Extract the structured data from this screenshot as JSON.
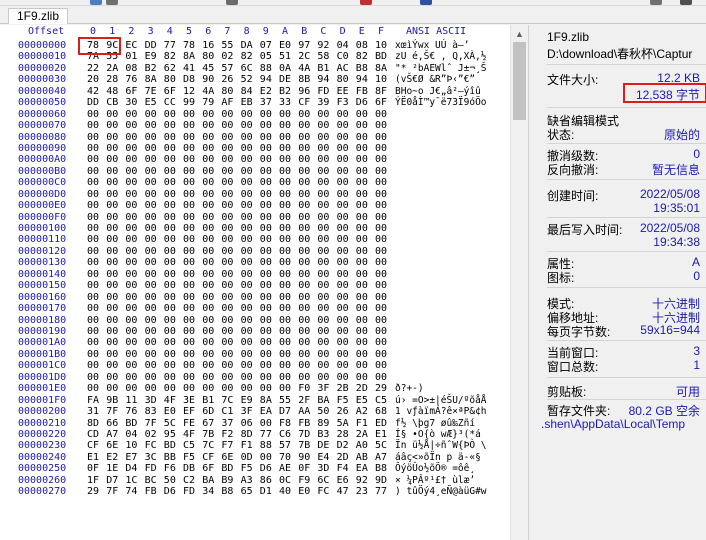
{
  "tab": {
    "label": "1F9.zlib"
  },
  "hex_header": {
    "offset_label": "Offset",
    "columns": [
      "0",
      "1",
      "2",
      "3",
      "4",
      "5",
      "6",
      "7",
      "8",
      "9",
      "A",
      "B",
      "C",
      "D",
      "E",
      "F"
    ],
    "ascii_label": "ANSI ASCII"
  },
  "hex_rows": [
    {
      "offset": "00000000",
      "bytes": [
        "78",
        "9C",
        "EC",
        "DD",
        "77",
        "78",
        "16",
        "55",
        "DA",
        "07",
        "E0",
        "97",
        "92",
        "04",
        "08",
        "10"
      ],
      "ascii": "xœìÝwx UÚ  à—’"
    },
    {
      "offset": "00000010",
      "bytes": [
        "7A",
        "55",
        "01",
        "E9",
        "82",
        "8A",
        "80",
        "02",
        "82",
        "05",
        "51",
        "2C",
        "58",
        "C0",
        "82",
        "BD"
      ],
      "ascii": "zU é,Š€ , Q,XÀ,½"
    },
    {
      "offset": "00000020",
      "bytes": [
        "22",
        "2A",
        "08",
        "B2",
        "62",
        "41",
        "45",
        "57",
        "6C",
        "88",
        "0A",
        "4A",
        "B1",
        "AC",
        "B8",
        "8A"
      ],
      "ascii": "\"* ²bAEWlˆ J±¬¸Š"
    },
    {
      "offset": "00000030",
      "bytes": [
        "20",
        "28",
        "76",
        "8A",
        "80",
        "D8",
        "90",
        "26",
        "52",
        "94",
        "DE",
        "8B",
        "94",
        "80",
        "94",
        "10"
      ],
      "ascii": " (vŠ€Ø &R”Þ‹”€”"
    },
    {
      "offset": "00000040",
      "bytes": [
        "42",
        "48",
        "6F",
        "7E",
        "6F",
        "12",
        "4A",
        "80",
        "84",
        "E2",
        "B2",
        "96",
        "FD",
        "EE",
        "FB",
        "8F"
      ],
      "ascii": "BHo~o J€„â²–ýîû"
    },
    {
      "offset": "00000050",
      "bytes": [
        "DD",
        "CB",
        "30",
        "E5",
        "CC",
        "99",
        "79",
        "AF",
        "EB",
        "37",
        "33",
        "CF",
        "39",
        "F3",
        "D6",
        "6F"
      ],
      "ascii": "ÝË0åÌ™y¯ë73Ï9óÖo"
    },
    {
      "offset": "00000060",
      "bytes": [
        "00",
        "00",
        "00",
        "00",
        "00",
        "00",
        "00",
        "00",
        "00",
        "00",
        "00",
        "00",
        "00",
        "00",
        "00",
        "00"
      ],
      "ascii": ""
    },
    {
      "offset": "00000070",
      "bytes": [
        "00",
        "00",
        "00",
        "00",
        "00",
        "00",
        "00",
        "00",
        "00",
        "00",
        "00",
        "00",
        "00",
        "00",
        "00",
        "00"
      ],
      "ascii": ""
    },
    {
      "offset": "00000080",
      "bytes": [
        "00",
        "00",
        "00",
        "00",
        "00",
        "00",
        "00",
        "00",
        "00",
        "00",
        "00",
        "00",
        "00",
        "00",
        "00",
        "00"
      ],
      "ascii": ""
    },
    {
      "offset": "00000090",
      "bytes": [
        "00",
        "00",
        "00",
        "00",
        "00",
        "00",
        "00",
        "00",
        "00",
        "00",
        "00",
        "00",
        "00",
        "00",
        "00",
        "00"
      ],
      "ascii": ""
    },
    {
      "offset": "000000A0",
      "bytes": [
        "00",
        "00",
        "00",
        "00",
        "00",
        "00",
        "00",
        "00",
        "00",
        "00",
        "00",
        "00",
        "00",
        "00",
        "00",
        "00"
      ],
      "ascii": ""
    },
    {
      "offset": "000000B0",
      "bytes": [
        "00",
        "00",
        "00",
        "00",
        "00",
        "00",
        "00",
        "00",
        "00",
        "00",
        "00",
        "00",
        "00",
        "00",
        "00",
        "00"
      ],
      "ascii": ""
    },
    {
      "offset": "000000C0",
      "bytes": [
        "00",
        "00",
        "00",
        "00",
        "00",
        "00",
        "00",
        "00",
        "00",
        "00",
        "00",
        "00",
        "00",
        "00",
        "00",
        "00"
      ],
      "ascii": ""
    },
    {
      "offset": "000000D0",
      "bytes": [
        "00",
        "00",
        "00",
        "00",
        "00",
        "00",
        "00",
        "00",
        "00",
        "00",
        "00",
        "00",
        "00",
        "00",
        "00",
        "00"
      ],
      "ascii": ""
    },
    {
      "offset": "000000E0",
      "bytes": [
        "00",
        "00",
        "00",
        "00",
        "00",
        "00",
        "00",
        "00",
        "00",
        "00",
        "00",
        "00",
        "00",
        "00",
        "00",
        "00"
      ],
      "ascii": ""
    },
    {
      "offset": "000000F0",
      "bytes": [
        "00",
        "00",
        "00",
        "00",
        "00",
        "00",
        "00",
        "00",
        "00",
        "00",
        "00",
        "00",
        "00",
        "00",
        "00",
        "00"
      ],
      "ascii": ""
    },
    {
      "offset": "00000100",
      "bytes": [
        "00",
        "00",
        "00",
        "00",
        "00",
        "00",
        "00",
        "00",
        "00",
        "00",
        "00",
        "00",
        "00",
        "00",
        "00",
        "00"
      ],
      "ascii": ""
    },
    {
      "offset": "00000110",
      "bytes": [
        "00",
        "00",
        "00",
        "00",
        "00",
        "00",
        "00",
        "00",
        "00",
        "00",
        "00",
        "00",
        "00",
        "00",
        "00",
        "00"
      ],
      "ascii": ""
    },
    {
      "offset": "00000120",
      "bytes": [
        "00",
        "00",
        "00",
        "00",
        "00",
        "00",
        "00",
        "00",
        "00",
        "00",
        "00",
        "00",
        "00",
        "00",
        "00",
        "00"
      ],
      "ascii": ""
    },
    {
      "offset": "00000130",
      "bytes": [
        "00",
        "00",
        "00",
        "00",
        "00",
        "00",
        "00",
        "00",
        "00",
        "00",
        "00",
        "00",
        "00",
        "00",
        "00",
        "00"
      ],
      "ascii": ""
    },
    {
      "offset": "00000140",
      "bytes": [
        "00",
        "00",
        "00",
        "00",
        "00",
        "00",
        "00",
        "00",
        "00",
        "00",
        "00",
        "00",
        "00",
        "00",
        "00",
        "00"
      ],
      "ascii": ""
    },
    {
      "offset": "00000150",
      "bytes": [
        "00",
        "00",
        "00",
        "00",
        "00",
        "00",
        "00",
        "00",
        "00",
        "00",
        "00",
        "00",
        "00",
        "00",
        "00",
        "00"
      ],
      "ascii": ""
    },
    {
      "offset": "00000160",
      "bytes": [
        "00",
        "00",
        "00",
        "00",
        "00",
        "00",
        "00",
        "00",
        "00",
        "00",
        "00",
        "00",
        "00",
        "00",
        "00",
        "00"
      ],
      "ascii": ""
    },
    {
      "offset": "00000170",
      "bytes": [
        "00",
        "00",
        "00",
        "00",
        "00",
        "00",
        "00",
        "00",
        "00",
        "00",
        "00",
        "00",
        "00",
        "00",
        "00",
        "00"
      ],
      "ascii": ""
    },
    {
      "offset": "00000180",
      "bytes": [
        "00",
        "00",
        "00",
        "00",
        "00",
        "00",
        "00",
        "00",
        "00",
        "00",
        "00",
        "00",
        "00",
        "00",
        "00",
        "00"
      ],
      "ascii": ""
    },
    {
      "offset": "00000190",
      "bytes": [
        "00",
        "00",
        "00",
        "00",
        "00",
        "00",
        "00",
        "00",
        "00",
        "00",
        "00",
        "00",
        "00",
        "00",
        "00",
        "00"
      ],
      "ascii": ""
    },
    {
      "offset": "000001A0",
      "bytes": [
        "00",
        "00",
        "00",
        "00",
        "00",
        "00",
        "00",
        "00",
        "00",
        "00",
        "00",
        "00",
        "00",
        "00",
        "00",
        "00"
      ],
      "ascii": ""
    },
    {
      "offset": "000001B0",
      "bytes": [
        "00",
        "00",
        "00",
        "00",
        "00",
        "00",
        "00",
        "00",
        "00",
        "00",
        "00",
        "00",
        "00",
        "00",
        "00",
        "00"
      ],
      "ascii": ""
    },
    {
      "offset": "000001C0",
      "bytes": [
        "00",
        "00",
        "00",
        "00",
        "00",
        "00",
        "00",
        "00",
        "00",
        "00",
        "00",
        "00",
        "00",
        "00",
        "00",
        "00"
      ],
      "ascii": ""
    },
    {
      "offset": "000001D0",
      "bytes": [
        "00",
        "00",
        "00",
        "00",
        "00",
        "00",
        "00",
        "00",
        "00",
        "00",
        "00",
        "00",
        "00",
        "00",
        "00",
        "00"
      ],
      "ascii": ""
    },
    {
      "offset": "000001E0",
      "bytes": [
        "00",
        "00",
        "00",
        "00",
        "00",
        "00",
        "00",
        "00",
        "00",
        "00",
        "00",
        "F0",
        "3F",
        "2B",
        "2D",
        "29"
      ],
      "ascii": "ð?+-)"
    },
    {
      "offset": "000001F0",
      "bytes": [
        "FA",
        "9B",
        "11",
        "3D",
        "4F",
        "3E",
        "B1",
        "7C",
        "E9",
        "8A",
        "55",
        "2F",
        "BA",
        "F5",
        "E5",
        "C5"
      ],
      "ascii": "ú› =O>±|éŠU/ºõåÅ"
    },
    {
      "offset": "00000200",
      "bytes": [
        "31",
        "7F",
        "76",
        "83",
        "E0",
        "EF",
        "6D",
        "C1",
        "3F",
        "EA",
        "D7",
        "AA",
        "50",
        "26",
        "A2",
        "68"
      ],
      "ascii": "1 vƒàïmÁ?ê×ªP&¢h"
    },
    {
      "offset": "00000210",
      "bytes": [
        "8D",
        "66",
        "BD",
        "7F",
        "5C",
        "FE",
        "67",
        "37",
        "06",
        "00",
        "F8",
        "FB",
        "89",
        "5A",
        "F1",
        "ED"
      ],
      "ascii": "f½ \\þg7  øû‰Zñí"
    },
    {
      "offset": "00000220",
      "bytes": [
        "CD",
        "A7",
        "04",
        "02",
        "95",
        "4F",
        "7B",
        "F2",
        "8D",
        "77",
        "C6",
        "7D",
        "B3",
        "28",
        "2A",
        "E1"
      ],
      "ascii": "Í§  •O{ò wÆ}³(*á"
    },
    {
      "offset": "00000230",
      "bytes": [
        "CF",
        "6E",
        "10",
        "FC",
        "BD",
        "C5",
        "7C",
        "F7",
        "F1",
        "88",
        "57",
        "7B",
        "DE",
        "D2",
        "A0",
        "5C"
      ],
      "ascii": "Ïn ü½Å|÷ñˆW{ÞÒ \\"
    },
    {
      "offset": "00000240",
      "bytes": [
        "E1",
        "E2",
        "E7",
        "3C",
        "BB",
        "F5",
        "CF",
        "6E",
        "0D",
        "00",
        "70",
        "90",
        "E4",
        "2D",
        "AB",
        "A7"
      ],
      "ascii": "áâç<»õÏn  p ä-«§"
    },
    {
      "offset": "00000250",
      "bytes": [
        "0F",
        "1E",
        "D4",
        "FD",
        "F6",
        "DB",
        "6F",
        "BD",
        "F5",
        "D6",
        "AE",
        "0F",
        "3D",
        "F4",
        "EA",
        "B8"
      ],
      "ascii": "  ÔýöÛo½õÖ® =ôê¸"
    },
    {
      "offset": "00000260",
      "bytes": [
        "1F",
        "D7",
        "1C",
        "BC",
        "50",
        "C2",
        "BA",
        "B9",
        "A3",
        "86",
        "0C",
        "F9",
        "6C",
        "E6",
        "92",
        "9D"
      ],
      "ascii": " × ¼PÂº¹£† ùlæ’"
    },
    {
      "offset": "00000270",
      "bytes": [
        "29",
        "7F",
        "74",
        "FB",
        "D6",
        "FD",
        "34",
        "B8",
        "65",
        "D1",
        "40",
        "E0",
        "FC",
        "47",
        "23",
        "77"
      ],
      "ascii": ") tûÖý4¸eÑ@àüG#w"
    }
  ],
  "sidebar": {
    "file_name": "1F9.zlib",
    "file_path": "D:\\download\\春秋杯\\Captur",
    "file_size_label": "文件大小:",
    "file_size_kb": "12.2 KB",
    "file_size_bytes": "12,538 字节",
    "default_edit_mode": "缺省编辑模式",
    "state_label": "状态:",
    "state_value": "原始的",
    "undo_level_label": "撤消级数:",
    "undo_level_value": "0",
    "redo_label": "反向撤消:",
    "redo_value": "暂无信息",
    "created_label": "创建时间:",
    "created_date": "2022/05/08",
    "created_time": "19:35:01",
    "modified_label": "最后写入时间:",
    "modified_date": "2022/05/08",
    "modified_time": "19:34:38",
    "attr_label": "属性:",
    "attr_value": "A",
    "icons_label": "图标:",
    "icons_value": "0",
    "mode_label": "模式:",
    "mode_value": "十六进制",
    "offset_addr_label": "偏移地址:",
    "offset_addr_value": "十六进制",
    "bytes_per_page_label": "每页字节数:",
    "bytes_per_page_value": "59x16=944",
    "current_window_label": "当前窗口:",
    "current_window_value": "3",
    "window_total_label": "窗口总数:",
    "window_total_value": "1",
    "clipboard_label": "剪贴板:",
    "clipboard_value": "可用",
    "temp_label": "暂存文件夹:",
    "temp_value": "80.2 GB 空余",
    "temp_path": ".shen\\AppData\\Local\\Temp"
  },
  "colors": {
    "accent_value": "#1a1ab0",
    "highlight_box": "#e01b1b"
  }
}
